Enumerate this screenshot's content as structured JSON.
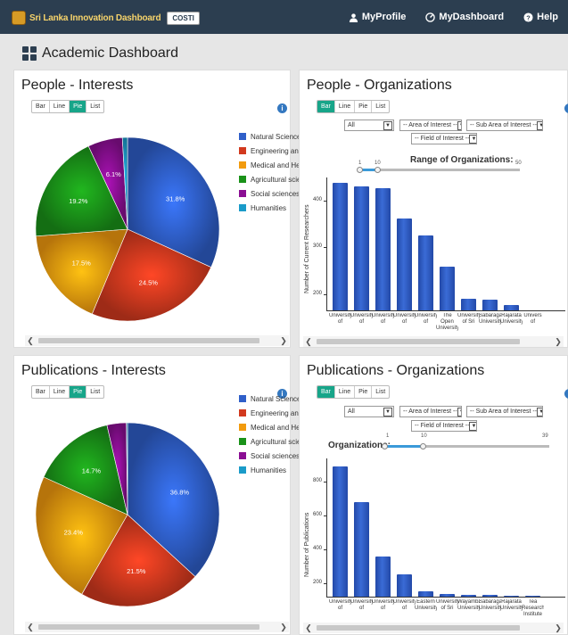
{
  "nav": {
    "brand": "Sri Lanka Innovation Dashboard",
    "badge": "COSTI",
    "links": [
      {
        "label": "MyProfile",
        "icon": "user-icon"
      },
      {
        "label": "MyDashboard",
        "icon": "dashboard-icon"
      },
      {
        "label": "Help",
        "icon": "help-icon"
      }
    ]
  },
  "page": {
    "title": "Academic Dashboard"
  },
  "chart_tabs": [
    "Bar",
    "Line",
    "Pie",
    "List"
  ],
  "legend": [
    {
      "label": "Natural Science",
      "color": "#2f5fc9"
    },
    {
      "label": "Engineering and Technology",
      "color": "#d2391e"
    },
    {
      "label": "Medical and Health Sciences",
      "color": "#f29b0e"
    },
    {
      "label": "Agricultural sciences",
      "color": "#1a9219"
    },
    {
      "label": "Social sciences",
      "color": "#8a0e93"
    },
    {
      "label": "Humanities",
      "color": "#1a9bc9"
    }
  ],
  "filters": {
    "all": "All",
    "area": "-- Area of Interest --",
    "subarea": "-- Sub Area of Interest --",
    "field": "-- Field of Interest --"
  },
  "panels": {
    "people_interests": {
      "title": "People - Interests",
      "active_tab": "Pie"
    },
    "people_orgs": {
      "title": "People - Organizations",
      "active_tab": "Bar",
      "range_title": "Range of Organizations:",
      "range": {
        "min": "1",
        "value": "10",
        "max": "50"
      }
    },
    "pub_interests": {
      "title": "Publications - Interests",
      "active_tab": "Pie"
    },
    "pub_orgs": {
      "title": "Publications - Organizations",
      "active_tab": "Bar",
      "range_title": "Organizations:",
      "range": {
        "min": "1",
        "value": "10",
        "max": "39"
      }
    }
  },
  "chart_data": [
    {
      "type": "pie",
      "title": "People - Interests",
      "categories": [
        "Natural Science",
        "Engineering and Technology",
        "Medical and Health Sciences",
        "Agricultural sciences",
        "Social sciences",
        "Humanities"
      ],
      "values": [
        31.8,
        24.5,
        17.5,
        19.2,
        6.1,
        0.9
      ],
      "labels": [
        "31.8%",
        "24.5%",
        "17.5%",
        "19.2%",
        "6.1%",
        ""
      ]
    },
    {
      "type": "bar",
      "title": "People - Organizations",
      "ylabel": "Number of Current Researchers",
      "ylim": [
        165,
        450
      ],
      "yticks": [
        200,
        300,
        400
      ],
      "categories": [
        "University of",
        "University of",
        "University of",
        "University of",
        "University of",
        "The Open University",
        "University of Sri",
        "Sabaragamuwa University",
        "Rajarata University",
        "Univers of"
      ],
      "values": [
        438,
        430,
        428,
        362,
        326,
        258,
        190,
        188,
        176,
        155
      ]
    },
    {
      "type": "pie",
      "title": "Publications - Interests",
      "categories": [
        "Natural Science",
        "Engineering and Technology",
        "Medical and Health Sciences",
        "Agricultural sciences",
        "Social sciences",
        "Humanities"
      ],
      "values": [
        36.8,
        21.5,
        23.4,
        14.7,
        3.4,
        0.2
      ],
      "labels": [
        "36.8%",
        "21.5%",
        "23.4%",
        "14.7%",
        "",
        ""
      ]
    },
    {
      "type": "bar",
      "title": "Publications - Organizations",
      "ylabel": "Number of Publications",
      "ylim": [
        120,
        940
      ],
      "yticks": [
        200,
        400,
        600,
        800
      ],
      "categories": [
        "University of",
        "University of",
        "University of",
        "University of",
        "Eastern University,",
        "University of Sri",
        "Wayamba University",
        "Sabaragamuwa University",
        "Rajarata University",
        "Tea Research Institute"
      ],
      "values": [
        895,
        680,
        358,
        250,
        150,
        138,
        130,
        128,
        127,
        125
      ]
    }
  ]
}
